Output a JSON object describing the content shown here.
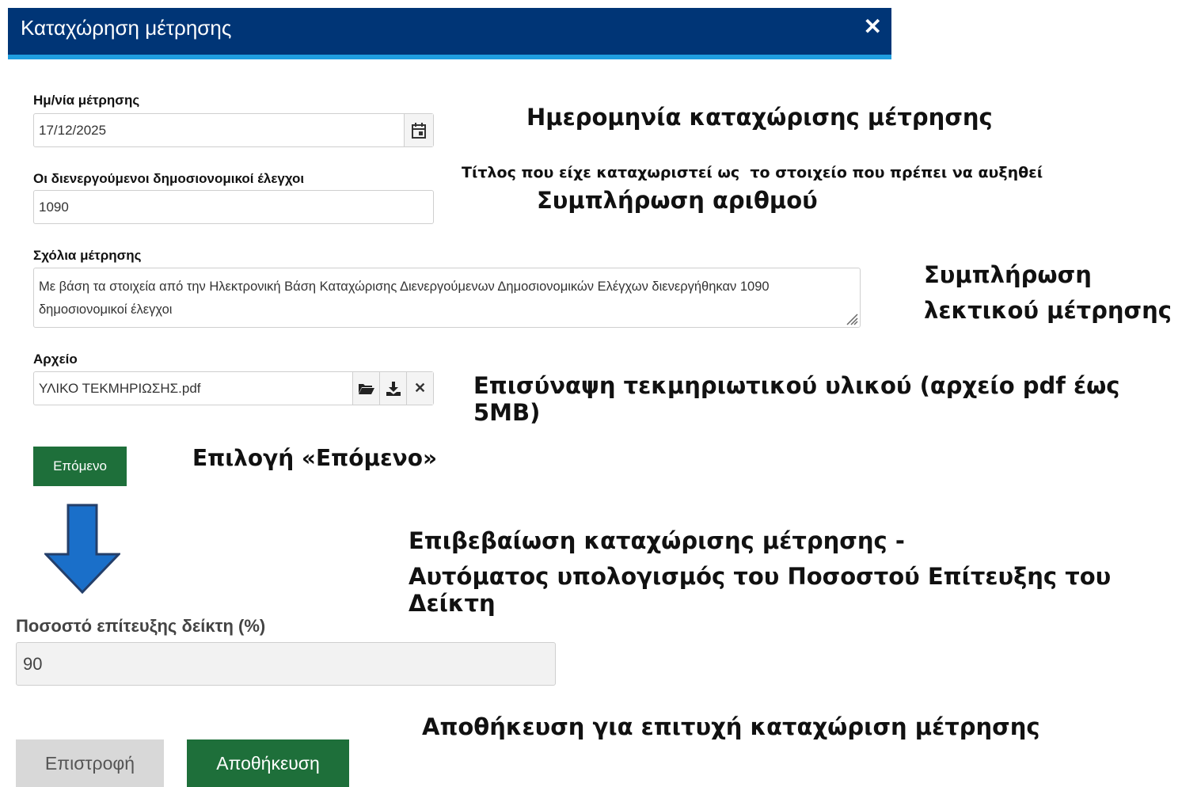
{
  "dialog": {
    "title": "Καταχώρηση μέτρησης",
    "close_label": "✕"
  },
  "fields": {
    "date": {
      "label": "Ημ/νία μέτρησης",
      "value": "17/12/2025"
    },
    "fiscal_checks": {
      "label": "Οι διενεργούμενοι δημοσιονομικοί έλεγχοι",
      "value": "1090"
    },
    "comments": {
      "label": "Σχόλια μέτρησης",
      "value": "Με βάση τα στοιχεία από την Ηλεκτρονική Βάση Καταχώρισης Διενεργούμενων Δημοσιονομικών Ελέγχων διενεργήθηκαν 1090 δημοσιονομικοί έλεγχοι"
    },
    "file": {
      "label": "Αρχείο",
      "value": "ΥΛΙΚΟ ΤΕΚΜΗΡΙΩΣΗΣ.pdf"
    }
  },
  "next_button": "Επόμενο",
  "percentage": {
    "label": "Ποσοστό επίτευξης δείκτη (%)",
    "value": "90"
  },
  "buttons": {
    "back": "Επιστροφή",
    "save": "Αποθήκευση"
  },
  "annotations": {
    "date_note": "Ημερομηνία καταχώρισης μέτρησης",
    "title_note": "Τίτλος που είχε καταχωριστεί ως  το στοιχείο που πρέπει να αυξηθεί",
    "number_note": "Συμπλήρωση αριθμού",
    "comments_note_1": "Συμπλήρωση",
    "comments_note_2": "λεκτικού μέτρησης",
    "file_note": "Επισύναψη τεκμηριωτικού υλικού (αρχείο pdf έως 5MB)",
    "next_note": "Επιλογή «Επόμενο»",
    "confirm_note_1": "Επιβεβαίωση καταχώρισης μέτρησης -",
    "confirm_note_2": "Αυτόματος υπολογισμός του Ποσοστού Επίτευξης του Δείκτη",
    "save_note": "Αποθήκευση για επιτυχή καταχώριση μέτρησης"
  },
  "colors": {
    "header": "#003576",
    "header_accent": "#1f9ee0",
    "green_button": "#1e6f3a",
    "arrow": "#1a6fc9"
  }
}
